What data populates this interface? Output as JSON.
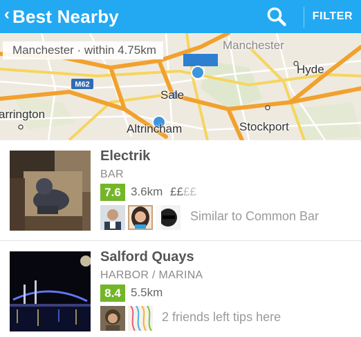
{
  "header": {
    "back_icon": "chevron-left-icon",
    "title": "Best Nearby",
    "search_icon": "search-icon",
    "filter_label": "FILTER",
    "background": "#23a9f2"
  },
  "map": {
    "location_text": "Manchester · within 4.75km",
    "places": {
      "manchester": "Manchester",
      "hyde": "Hyde",
      "sale": "Sale",
      "warrington": "arrington",
      "altrincham": "Altrincham",
      "stockport": "Stockport",
      "road_m62": "M62"
    }
  },
  "venues": [
    {
      "name": "Electrik",
      "category": "BAR",
      "score": "7.6",
      "score_color": "#74b52a",
      "distance": "3.6km",
      "price": "££",
      "price_dim": "££",
      "social_text": "Similar to Common Bar"
    },
    {
      "name": "Salford Quays",
      "category": "HARBOR / MARINA",
      "score": "8.4",
      "score_color": "#74b52a",
      "distance": "5.5km",
      "social_text": "2 friends left tips here"
    }
  ]
}
